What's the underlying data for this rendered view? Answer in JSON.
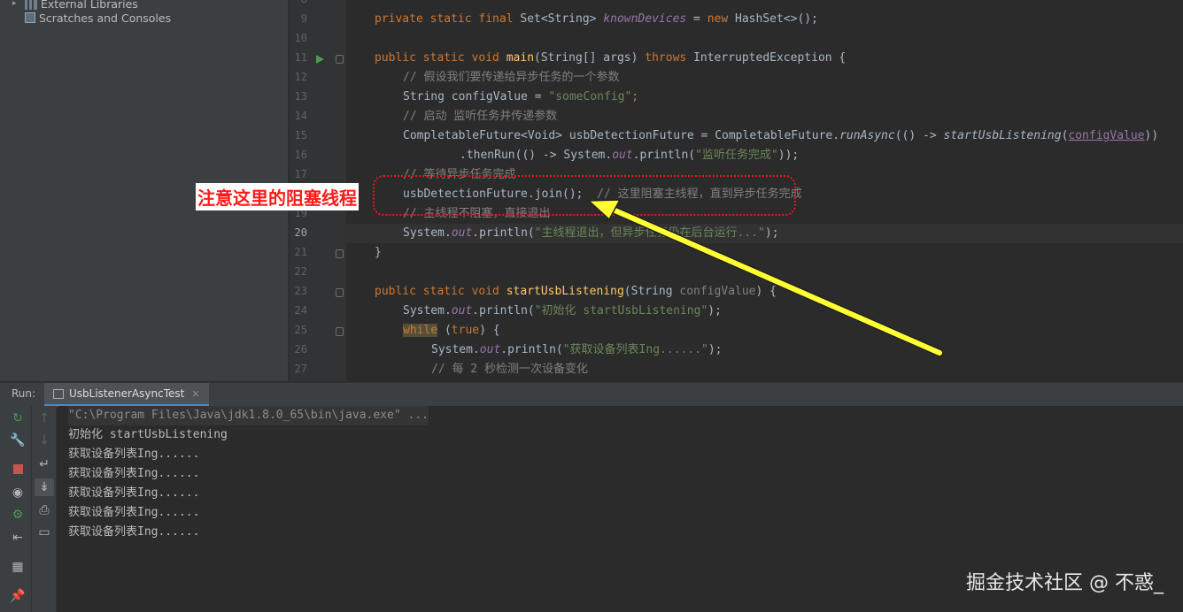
{
  "project_tree": {
    "items": [
      {
        "label": "External Libraries",
        "icon": "library-icon"
      },
      {
        "label": "Scratches and Consoles",
        "icon": "scratches-icon"
      }
    ]
  },
  "editor": {
    "line_numbers": [
      "8",
      "9",
      "10",
      "11",
      "12",
      "13",
      "14",
      "15",
      "16",
      "17",
      "18",
      "19",
      "20",
      "21",
      "22",
      "23",
      "24",
      "25",
      "26",
      "27"
    ],
    "current_line": "20",
    "code": {
      "l9": [
        "private static final ",
        "Set<String> ",
        "knownDevices",
        " = ",
        "new ",
        "HashSet<>();"
      ],
      "l11": [
        "public static void ",
        "main",
        "(String[] args) ",
        "throws ",
        "InterruptedException {"
      ],
      "l12": "// 假设我们要传递给异步任务的一个参数",
      "l13": [
        "String configValue = ",
        "\"someConfig\"",
        ";"
      ],
      "l14": "// 启动 监听任务并传递参数",
      "l15": [
        "CompletableFuture<Void> usbDetectionFuture = CompletableFuture.",
        "runAsync",
        "(() -> ",
        "startUsbListening",
        "(",
        "configValue",
        "))"
      ],
      "l16": [
        ".thenRun(() -> System.",
        "out",
        ".println(",
        "\"监听任务完成\"",
        "));"
      ],
      "l17": "// 等待异步任务完成",
      "l18": [
        "usbDetectionFuture.join();  ",
        "// 这里阻塞主线程，直到异步任务完成"
      ],
      "l19": "// 主线程不阻塞，直接退出",
      "l20": [
        "System.",
        "out",
        ".println(",
        "\"主线程退出，但异步任务仍在后台运行...\"",
        ");"
      ],
      "l21": "}",
      "l23": [
        "public static void ",
        "startUsbListening",
        "(String ",
        "configValue",
        ") {"
      ],
      "l24": [
        "System.",
        "out",
        ".println(",
        "\"初始化 startUsbListening\"",
        ");"
      ],
      "l25": [
        "while",
        " (",
        "true",
        ") {"
      ],
      "l26": [
        "System.",
        "out",
        ".println(",
        "\"获取设备列表Ing......\"",
        ");"
      ],
      "l27": "// 每 2 秒检测一次设备变化"
    }
  },
  "annotation": {
    "label": "注意这里的阻塞线程",
    "color": "#ff1a1a",
    "arrow_color": "#ffff33"
  },
  "run_window": {
    "run_label": "Run:",
    "tab_label": "UsbListenerAsyncTest",
    "console_lines": [
      "\"C:\\Program Files\\Java\\jdk1.8.0_65\\bin\\java.exe\" ...",
      "初始化 startUsbListening",
      "获取设备列表Ing......",
      "获取设备列表Ing......",
      "获取设备列表Ing......",
      "获取设备列表Ing......",
      "获取设备列表Ing......"
    ]
  },
  "watermark": "掘金技术社区 @ 不惑_",
  "colors": {
    "keyword": "#cc7832",
    "string": "#6a8759",
    "comment": "#808080",
    "method": "#ffc66d",
    "field": "#9876aa",
    "run_green": "#499c54",
    "stop_red": "#c75450"
  }
}
